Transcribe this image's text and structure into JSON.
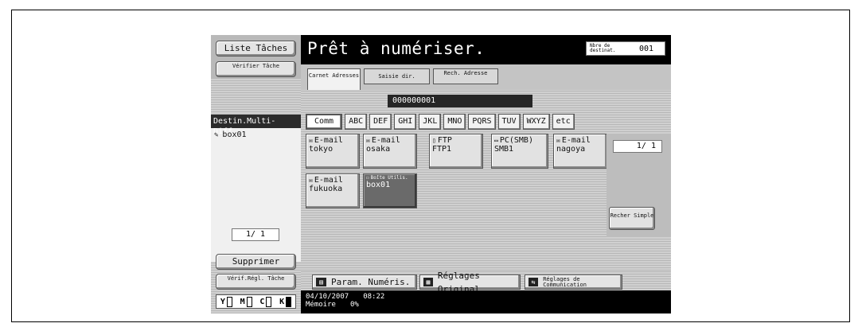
{
  "left": {
    "liste_taches": "Liste Tâches",
    "verifier_tache": "Vérifier Tâche",
    "dest_header": "Destin.Multi-Diff.",
    "dest_items": [
      {
        "label": "box01",
        "icon": "box-icon"
      }
    ],
    "page": "1/ 1",
    "supprimer": "Supprimer",
    "verif_regl": "Vérif.Régl. Tâche",
    "toner": [
      {
        "label": "Y",
        "level": "low"
      },
      {
        "label": "M",
        "level": "low"
      },
      {
        "label": "C",
        "level": "low"
      },
      {
        "label": "K",
        "level": "full"
      }
    ]
  },
  "header": {
    "title": "Prêt à numériser.",
    "nbre_label": "Nbre de destinat.",
    "nbre_value": "001"
  },
  "tabs": [
    {
      "label": "Carnet Adresses",
      "active": true
    },
    {
      "label": "Saisie dir.",
      "active": false
    },
    {
      "label": "Rech. Adresse",
      "active": false
    }
  ],
  "address_field": "000000001",
  "index_buttons": [
    "Comm",
    "ABC",
    "DEF",
    "GHI",
    "JKL",
    "MNO",
    "PQRS",
    "TUV",
    "WXYZ",
    "etc"
  ],
  "address_buttons": [
    {
      "type": "E-mail",
      "name": "tokyo",
      "icon": "mail-icon",
      "selected": false
    },
    {
      "type": "E-mail",
      "name": "osaka",
      "icon": "mail-icon",
      "selected": false
    },
    {
      "type": "FTP",
      "name": "FTP1",
      "icon": "ftp-icon",
      "selected": false
    },
    {
      "type": "PC(SMB)",
      "name": "SMB1",
      "icon": "pc-icon",
      "selected": false
    },
    {
      "type": "E-mail",
      "name": "nagoya",
      "icon": "mail-icon",
      "selected": false
    },
    {
      "type": "E-mail",
      "name": "fukuoka",
      "icon": "mail-icon",
      "selected": false
    },
    {
      "type": "Boîte Utilis.",
      "name": "box01",
      "icon": "box-icon",
      "selected": true
    }
  ],
  "page_indicator": "1/ 1",
  "recher_simple": "Recher Simple",
  "bottom_buttons": {
    "param": "Param. Numéris.",
    "reglages_original": "Réglages Original",
    "reglages_comm": "Réglages de Communication"
  },
  "status": {
    "date": "04/10/2007",
    "time": "08:22",
    "memory_label": "Mémoire",
    "memory_value": "0%"
  }
}
